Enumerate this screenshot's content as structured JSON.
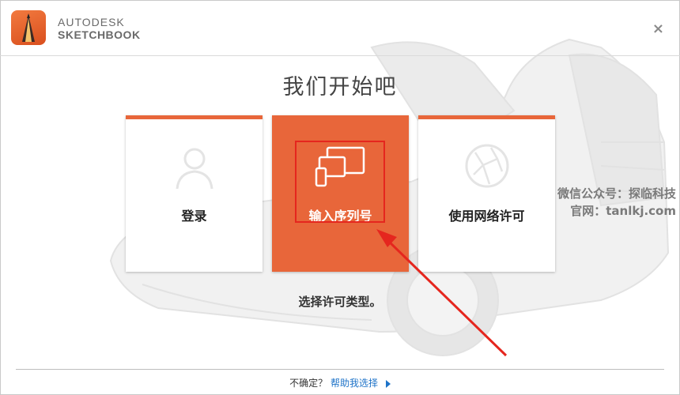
{
  "app": {
    "brand_line1": "AUTODESK",
    "brand_line2": "SKETCHBOOK",
    "close_glyph": "×"
  },
  "main": {
    "title": "我们开始吧",
    "cards": [
      {
        "label": "登录",
        "icon": "user-icon",
        "selected": false
      },
      {
        "label": "输入序列号",
        "icon": "devices-icon",
        "selected": true
      },
      {
        "label": "使用网络许可",
        "icon": "globe-network-icon",
        "selected": false
      }
    ],
    "hint": "选择许可类型。"
  },
  "watermark": {
    "line1": "微信公众号：探临科技",
    "line2": "官网：tanlkj.com"
  },
  "footer": {
    "question": "不确定？",
    "help_link": "帮助我选择"
  },
  "colors": {
    "accent": "#e8663a",
    "annotation_red": "#e5261e",
    "link": "#1e73c8"
  }
}
